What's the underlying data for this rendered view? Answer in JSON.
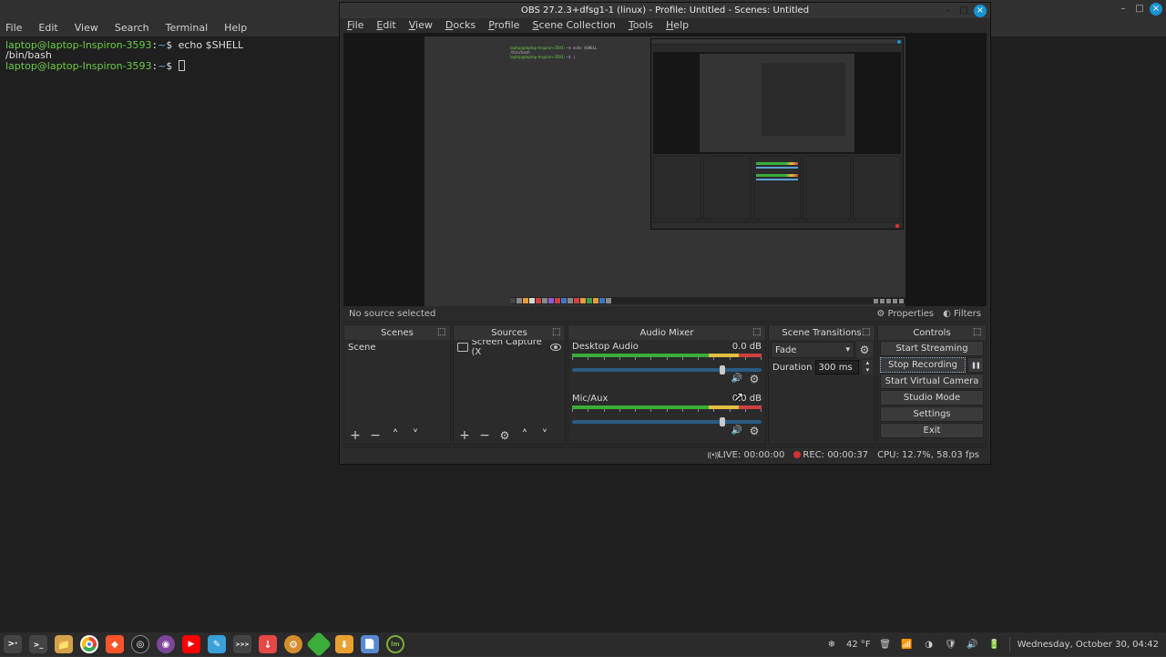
{
  "outer_window": {
    "min": "",
    "max": "",
    "close": ""
  },
  "terminal": {
    "menubar": [
      "File",
      "Edit",
      "View",
      "Search",
      "Terminal",
      "Help"
    ],
    "prompt_user": "laptop@laptop-Inspiron-3593",
    "prompt_path": "~",
    "lines": [
      {
        "cmd": "echo $SHELL"
      },
      {
        "out": "/bin/bash"
      },
      {
        "cmd": ""
      }
    ]
  },
  "obs": {
    "title": "OBS 27.2.3+dfsg1-1 (linux) - Profile: Untitled - Scenes: Untitled",
    "menubar": [
      "File",
      "Edit",
      "View",
      "Docks",
      "Profile",
      "Scene Collection",
      "Tools",
      "Help"
    ],
    "src_strip": {
      "status": "No source selected",
      "properties": "Properties",
      "filters": "Filters"
    },
    "panels": {
      "scenes": {
        "title": "Scenes",
        "items": [
          "Scene"
        ]
      },
      "sources": {
        "title": "Sources",
        "items": [
          {
            "label": "Screen Capture (X",
            "visible": true
          }
        ]
      },
      "audio": {
        "title": "Audio Mixer",
        "tracks": [
          {
            "name": "Desktop Audio",
            "db": "0.0 dB",
            "knob": 0.78,
            "muted": false
          },
          {
            "name": "Mic/Aux",
            "db": "0.0 dB",
            "knob": 0.78,
            "muted": false
          }
        ],
        "ticks": [
          "-60",
          "-55",
          "-50",
          "-45",
          "-40",
          "-35",
          "-30",
          "-25",
          "-20",
          "-15",
          "-10",
          "-5",
          "0"
        ]
      },
      "transitions": {
        "title": "Scene Transitions",
        "type": "Fade",
        "duration_label": "Duration",
        "duration_value": "300 ms"
      },
      "controls": {
        "title": "Controls",
        "start_streaming": "Start Streaming",
        "stop_recording": "Stop Recording",
        "start_virtual_cam": "Start Virtual Camera",
        "studio_mode": "Studio Mode",
        "settings": "Settings",
        "exit": "Exit"
      }
    },
    "status": {
      "live_label": "LIVE:",
      "live_time": "00:00:00",
      "rec_label": "REC:",
      "rec_time": "00:00:37",
      "cpu": "CPU: 12.7%, 58.03 fps"
    }
  },
  "taskbar": {
    "apps": [
      "start-menu",
      "terminal",
      "files",
      "chrome",
      "brave",
      "steam",
      "tor",
      "youtube",
      "text-editor",
      "multicommand",
      "todoist",
      "system-settings",
      "pencil",
      "downloader",
      "document",
      "mint-menu"
    ],
    "weather": "42 °F",
    "date": "Wednesday, October 30, 04:42"
  }
}
